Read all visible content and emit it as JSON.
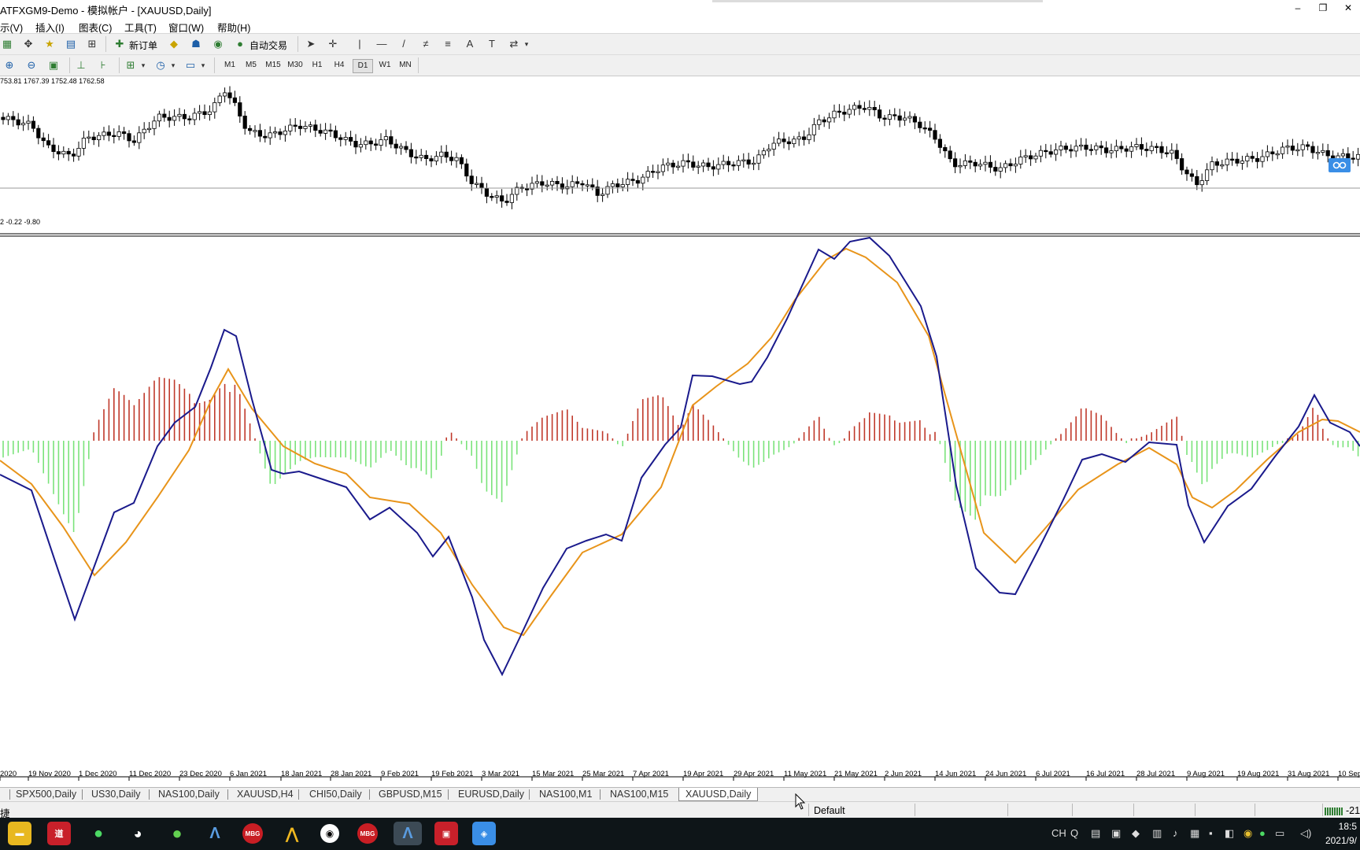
{
  "window": {
    "title": "ATFXGM9-Demo - 模拟帐户 - [XAUUSD,Daily]",
    "controls": [
      "–",
      "❐",
      "✕"
    ]
  },
  "menu": [
    "示(V)",
    "插入(I)",
    "图表(C)",
    "工具(T)",
    "窗口(W)",
    "帮助(H)"
  ],
  "toolbar": {
    "new_order_label": "新订单",
    "auto_trade_label": "自动交易",
    "timeframes": [
      "M1",
      "M5",
      "M15",
      "M30",
      "H1",
      "H4",
      "D1",
      "W1",
      "MN"
    ],
    "selected_timeframe": "D1"
  },
  "chart": {
    "price_info": "753.81 1767.39 1752.48 1762.58",
    "indicator_info": "2 -0.22 -9.80",
    "date_labels": [
      "2020",
      "19 Nov 2020",
      "1 Dec 2020",
      "11 Dec 2020",
      "23 Dec 2020",
      "6 Jan 2021",
      "18 Jan 2021",
      "28 Jan 2021",
      "9 Feb 2021",
      "19 Feb 2021",
      "3 Mar 2021",
      "15 Mar 2021",
      "25 Mar 2021",
      "7 Apr 2021",
      "19 Apr 2021",
      "29 Apr 2021",
      "11 May 2021",
      "21 May 2021",
      "2 Jun 2021",
      "14 Jun 2021",
      "24 Jun 2021",
      "6 Jul 2021",
      "16 Jul 2021",
      "28 Jul 2021",
      "9 Aug 2021",
      "19 Aug 2021",
      "31 Aug 2021",
      "10 Sep"
    ],
    "colors": {
      "up_hist": "#c0392b",
      "down_hist": "#7be37b",
      "macd": "#1a1a8c",
      "signal": "#e8941a",
      "candle": "#000000"
    }
  },
  "tabs": {
    "items": [
      "SPX500,Daily",
      "US30,Daily",
      "NAS100,Daily",
      "XAUUSD,H4",
      "CHI50,Daily",
      "GBPUSD,M15",
      "EURUSD,Daily",
      "NAS100,M1",
      "NAS100,M15",
      "XAUUSD,Daily"
    ],
    "active": "XAUUSD,Daily"
  },
  "status": {
    "left": "捷",
    "profile": "Default",
    "right": "-21"
  },
  "taskbar": {
    "apps": [
      "file-explorer",
      "youdao",
      "wechat",
      "qq",
      "360",
      "mt4-a",
      "mbg",
      "monitor-app",
      "obs",
      "mbg-2",
      "mt4-b",
      "presentation",
      "browser"
    ],
    "tray_lang": "CH",
    "time": "18:5",
    "date": "2021/9/"
  }
}
